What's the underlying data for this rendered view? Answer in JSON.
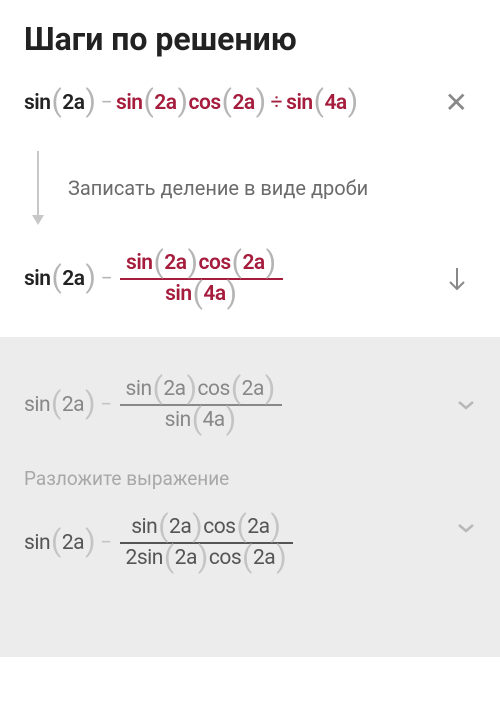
{
  "title": "Шаги по решению",
  "step1": {
    "expr": {
      "p1_fn": "sin",
      "p1_arg": "2a",
      "p2_fn": "sin",
      "p2_arg": "2a",
      "p3_fn": "cos",
      "p3_arg": "2a",
      "div": "÷",
      "p4_fn": "sin",
      "p4_arg": "4a"
    },
    "hint": "Записать деление в виде дроби"
  },
  "step2": {
    "lead_fn": "sin",
    "lead_arg": "2a",
    "num_fn1": "sin",
    "num_arg1": "2a",
    "num_fn2": "cos",
    "num_arg2": "2a",
    "den_fn": "sin",
    "den_arg": "4a"
  },
  "lower1": {
    "lead_fn": "sin",
    "lead_arg": "2a",
    "num_fn1": "sin",
    "num_arg1": "2a",
    "num_fn2": "cos",
    "num_arg2": "2a",
    "den_fn": "sin",
    "den_arg": "4a",
    "hint": "Разложите выражение"
  },
  "lower2": {
    "lead_fn": "sin",
    "lead_arg": "2a",
    "num_fn1": "sin",
    "num_arg1": "2a",
    "num_fn2": "cos",
    "num_arg2": "2a",
    "den_prefix": "2",
    "den_fn1": "sin",
    "den_arg1": "2a",
    "den_fn2": "cos",
    "den_arg2": "2a"
  }
}
